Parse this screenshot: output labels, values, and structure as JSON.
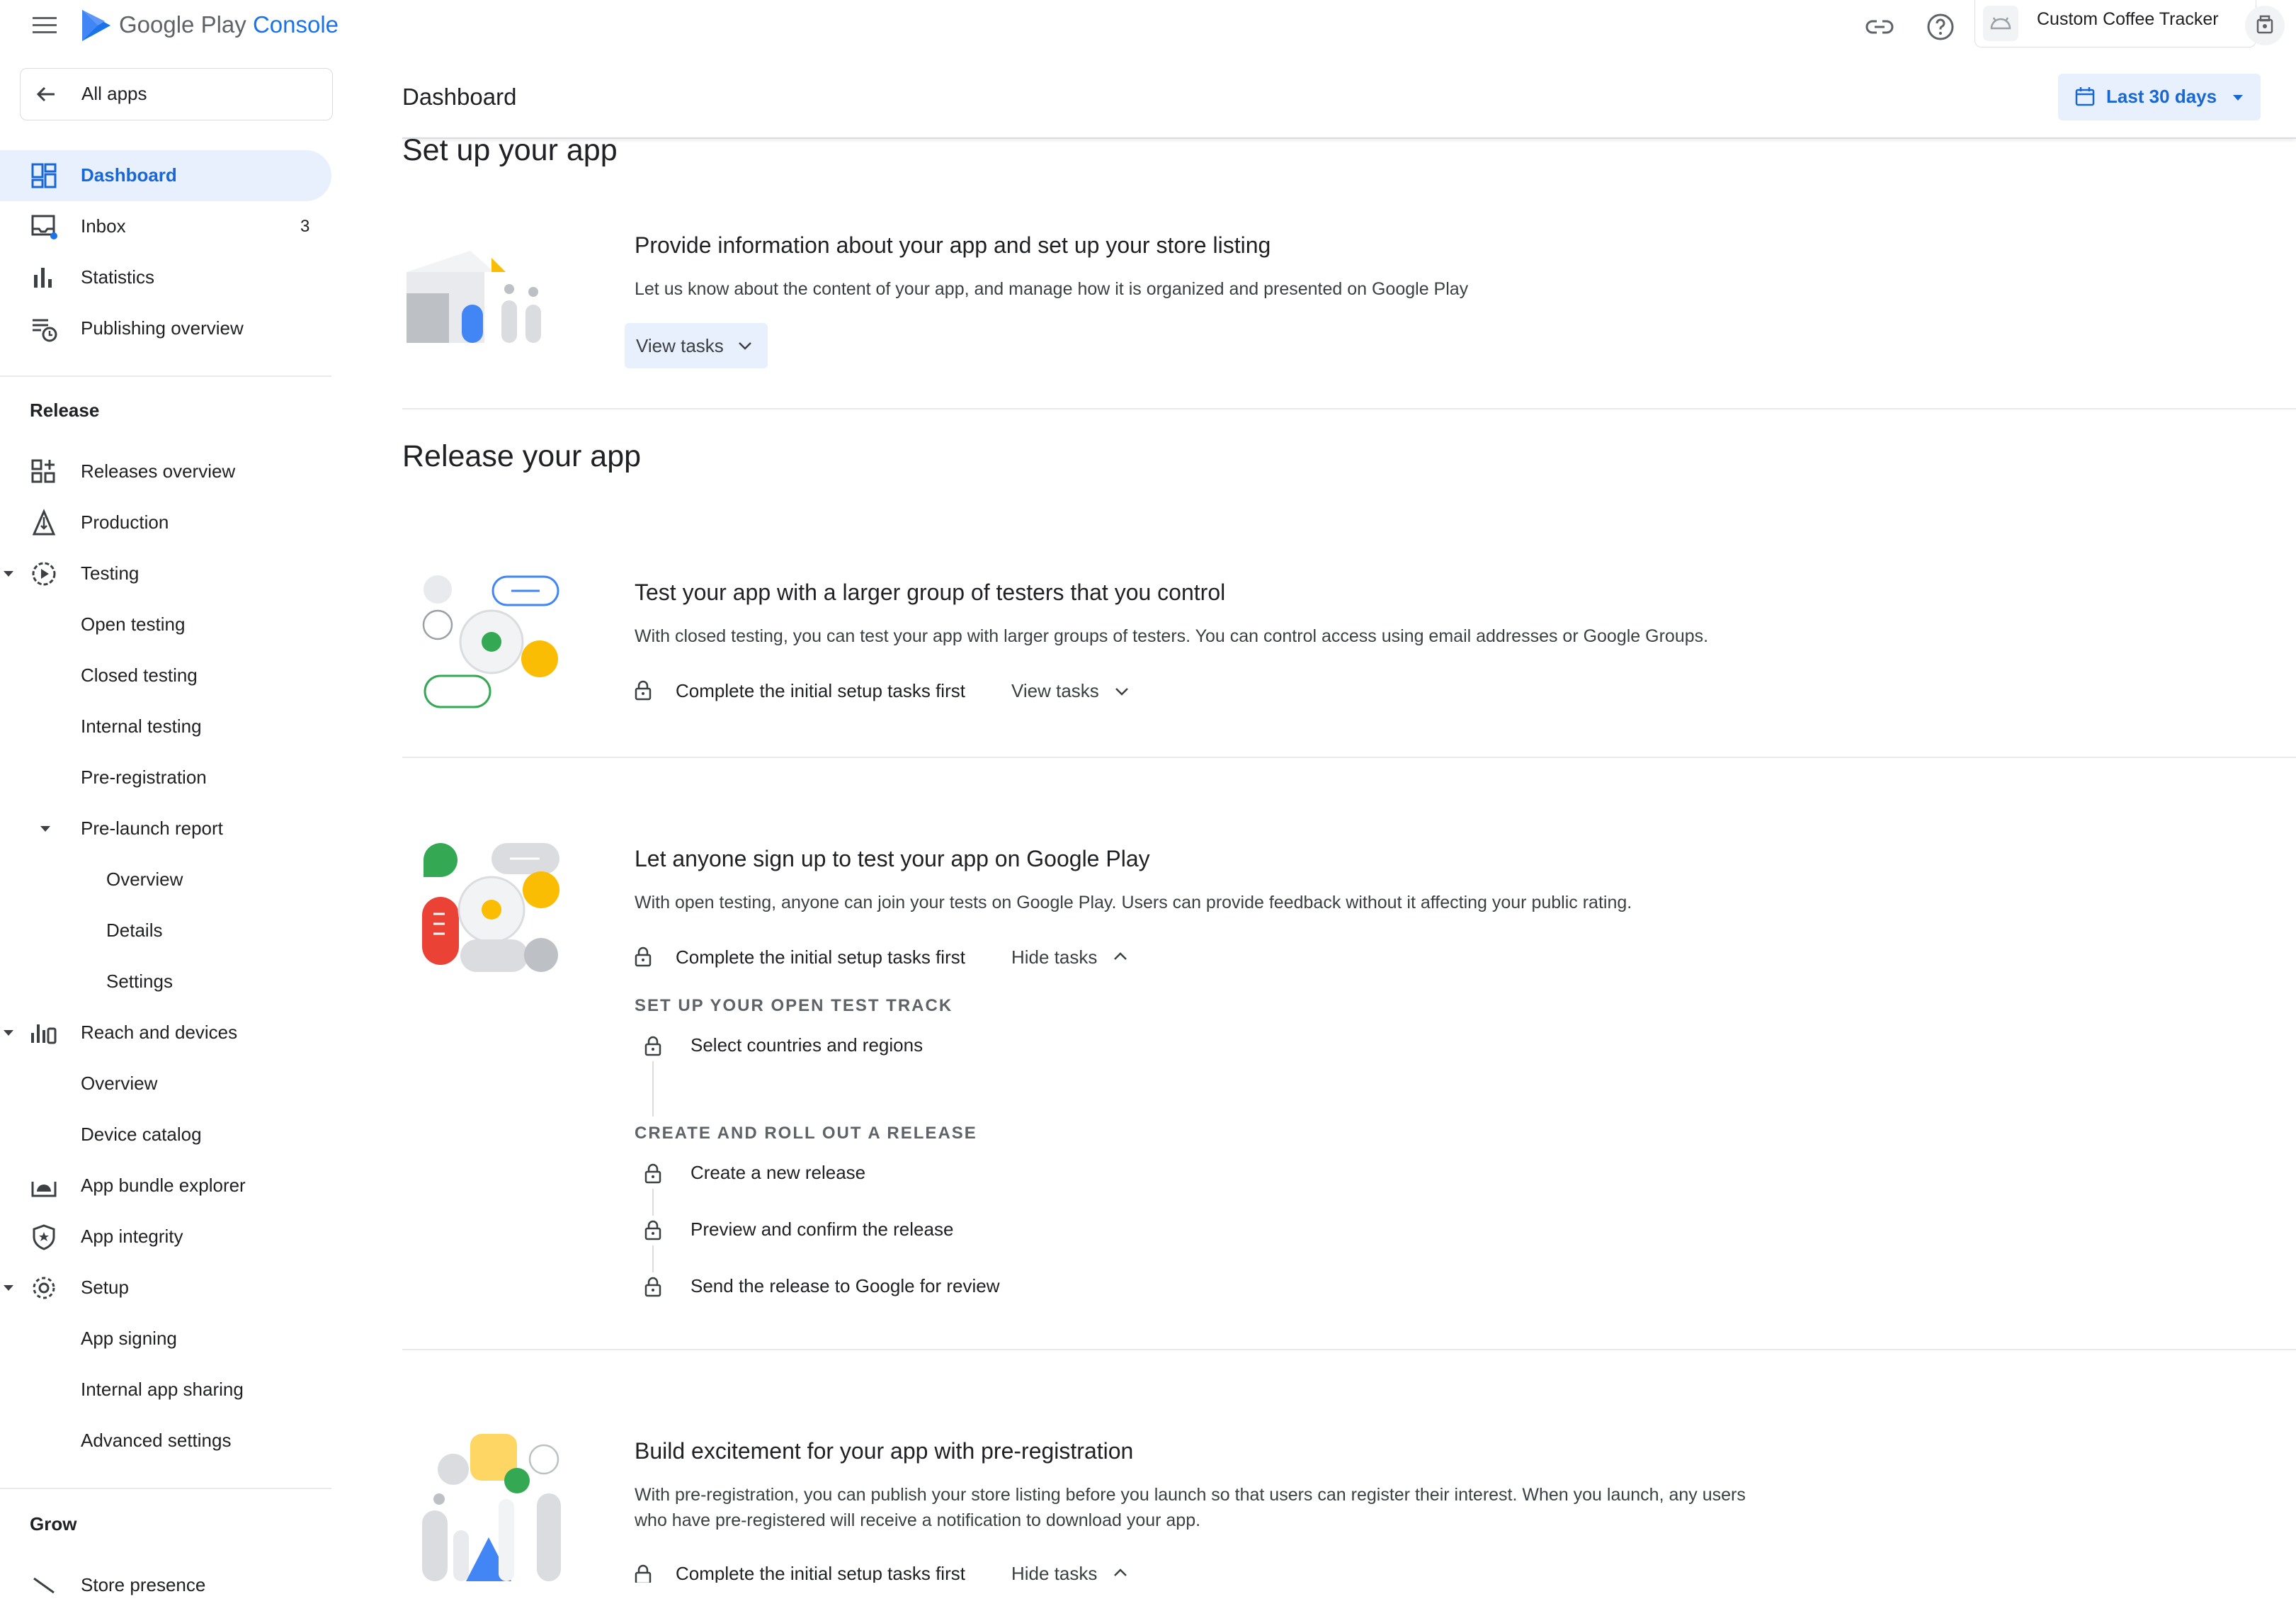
{
  "topbar": {
    "logo_text": "Google Play",
    "logo_console": "Console",
    "app_name": "Custom Coffee Tracker"
  },
  "sidebar": {
    "back_label": "All apps",
    "items": [
      {
        "label": "Dashboard",
        "icon": "dashboard-icon",
        "active": true
      },
      {
        "label": "Inbox",
        "icon": "inbox-icon",
        "badge": "3"
      },
      {
        "label": "Statistics",
        "icon": "bar-chart-icon"
      },
      {
        "label": "Publishing overview",
        "icon": "schedule-list-icon"
      }
    ],
    "release_title": "Release",
    "release_items": [
      {
        "label": "Releases overview",
        "icon": "grid-add-icon"
      },
      {
        "label": "Production",
        "icon": "triangle-flag-icon"
      },
      {
        "label": "Testing",
        "icon": "play-circle-icon"
      },
      {
        "label": "Open testing"
      },
      {
        "label": "Closed testing"
      },
      {
        "label": "Internal testing"
      },
      {
        "label": "Pre-registration"
      },
      {
        "label": "Pre-launch report"
      },
      {
        "label": "Overview"
      },
      {
        "label": "Details"
      },
      {
        "label": "Settings"
      },
      {
        "label": "Reach and devices",
        "icon": "bar-device-icon"
      },
      {
        "label": "Overview"
      },
      {
        "label": "Device catalog"
      },
      {
        "label": "App bundle explorer",
        "icon": "android-box-icon"
      },
      {
        "label": "App integrity",
        "icon": "shield-icon"
      },
      {
        "label": "Setup",
        "icon": "gear-icon"
      },
      {
        "label": "App signing"
      },
      {
        "label": "Internal app sharing"
      },
      {
        "label": "Advanced settings"
      }
    ],
    "grow_title": "Grow",
    "grow_items": [
      {
        "label": "Store presence"
      }
    ]
  },
  "header": {
    "title": "Dashboard",
    "date_range": "Last 30 days"
  },
  "setup_section": {
    "title": "Set up your app",
    "card": {
      "title": "Provide information about your app and set up your store listing",
      "desc": "Let us know about the content of your app, and manage how it is organized and presented on Google Play",
      "button": "View tasks"
    }
  },
  "release_section": {
    "title": "Release your app",
    "cards": [
      {
        "title": "Test your app with a larger group of testers that you control",
        "desc": "With closed testing, you can test your app with larger groups of testers. You can control access using email addresses or Google Groups.",
        "lock_text": "Complete the initial setup tasks first",
        "toggle": "View tasks"
      },
      {
        "title": "Let anyone sign up to test your app on Google Play",
        "desc": "With open testing, anyone can join your tests on Google Play. Users can provide feedback without it affecting your public rating.",
        "lock_text": "Complete the initial setup tasks first",
        "toggle": "Hide tasks",
        "groups": [
          {
            "heading": "SET UP YOUR OPEN TEST TRACK",
            "tasks": [
              "Select countries and regions"
            ]
          },
          {
            "heading": "CREATE AND ROLL OUT A RELEASE",
            "tasks": [
              "Create a new release",
              "Preview and confirm the release",
              "Send the release to Google for review"
            ]
          }
        ]
      },
      {
        "title": "Build excitement for your app with pre-registration",
        "desc": "With pre-registration, you can publish your store listing before you launch so that users can register their interest. When you launch, any users who have pre-registered will receive a notification to download your app.",
        "lock_text": "Complete the initial setup tasks first",
        "toggle": "Hide tasks"
      }
    ]
  },
  "colors": {
    "accent": "#1a73e8",
    "active_bg": "#e8f0fe",
    "green": "#34a853",
    "yellow": "#fbbc04",
    "red": "#ea4335",
    "gray": "#dadce0"
  }
}
